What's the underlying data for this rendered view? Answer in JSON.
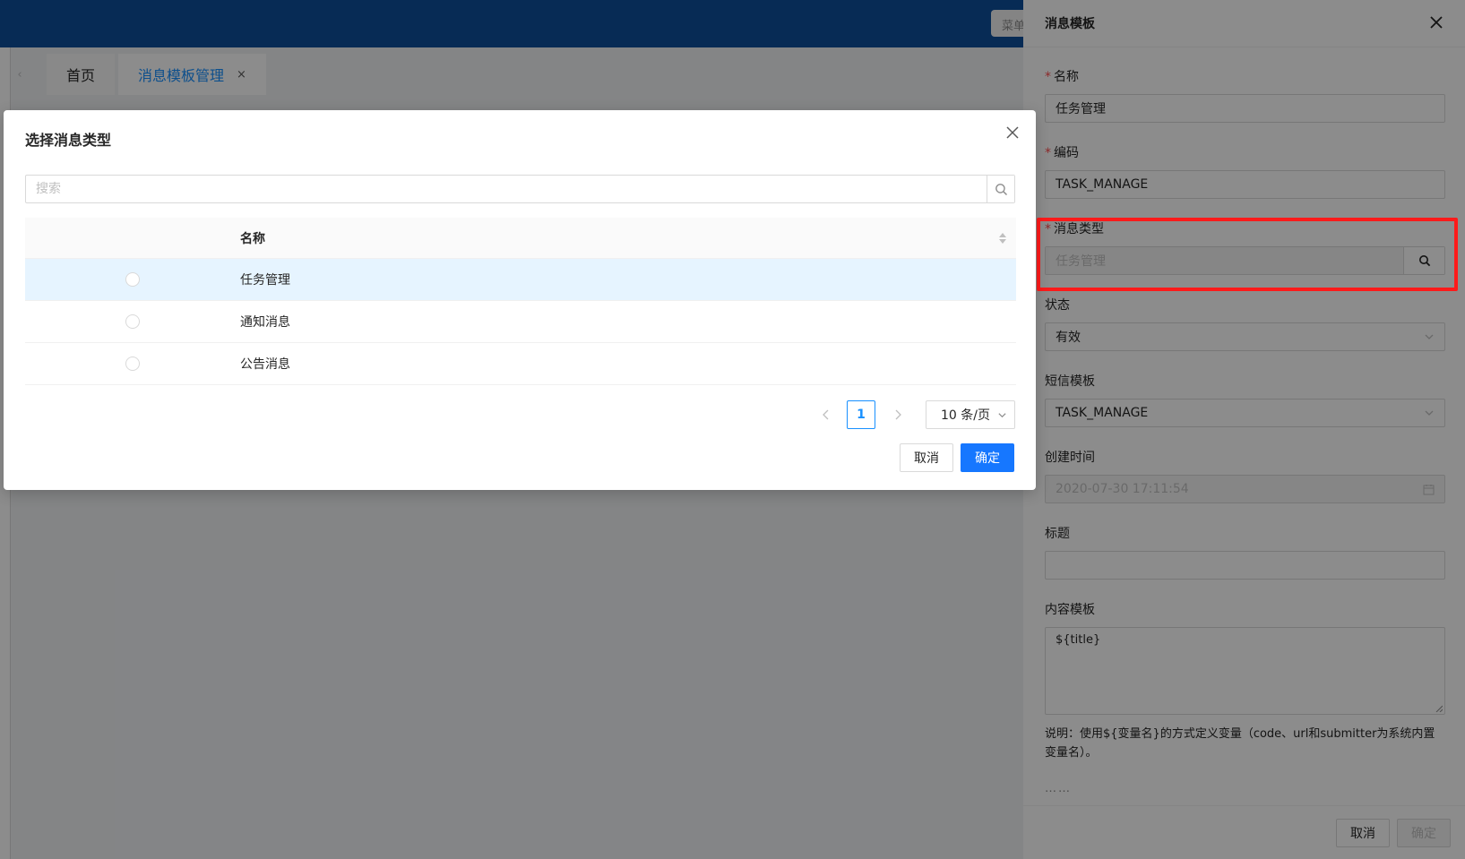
{
  "header": {
    "menu_button_label": "菜单"
  },
  "tabs": {
    "home": "首页",
    "active": "消息模板管理",
    "close_glyph": "×"
  },
  "picker": {
    "title": "选择消息类型",
    "search_placeholder": "搜索",
    "column_name": "名称",
    "rows": [
      {
        "name": "任务管理",
        "selected": true
      },
      {
        "name": "通知消息",
        "selected": false
      },
      {
        "name": "公告消息",
        "selected": false
      }
    ],
    "pagination": {
      "current_page": "1",
      "page_size": "10 条/页"
    },
    "cancel_label": "取消",
    "ok_label": "确定"
  },
  "drawer": {
    "title": "消息模板",
    "fields": {
      "name": {
        "label": "名称",
        "value": "任务管理"
      },
      "code": {
        "label": "编码",
        "value": "TASK_MANAGE"
      },
      "message_type": {
        "label": "消息类型",
        "value": "任务管理"
      },
      "status": {
        "label": "状态",
        "value": "有效"
      },
      "sms_template": {
        "label": "短信模板",
        "value": "TASK_MANAGE"
      },
      "created_time": {
        "label": "创建时间",
        "value": "2020-07-30 17:11:54"
      },
      "subject": {
        "label": "标题",
        "value": ""
      },
      "content_template": {
        "label": "内容模板",
        "value": "${title}"
      }
    },
    "note": "说明：使用${变量名}的方式定义变量（code、url和submitter为系统内置变量名）。",
    "more": "……",
    "cancel_label": "取消",
    "ok_label": "确定"
  },
  "colors": {
    "header_bg": "#0e4f9b",
    "primary": "#1677ff",
    "highlight": "#ff1a1a",
    "selected_row": "#e6f4ff"
  }
}
